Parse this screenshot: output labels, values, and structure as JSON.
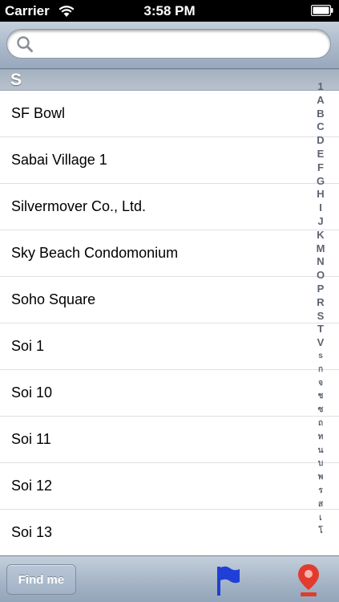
{
  "status_bar": {
    "carrier": "Carrier",
    "time": "3:58 PM"
  },
  "search": {
    "value": "",
    "placeholder": ""
  },
  "section": {
    "letter": "S"
  },
  "rows": [
    "SF Bowl",
    "Sabai Village 1",
    "Silvermover Co., Ltd.",
    "Sky Beach Condomonium",
    "Soho Square",
    "Soi 1",
    "Soi 10",
    "Soi 11",
    "Soi 12",
    "Soi 13"
  ],
  "index": [
    "1",
    "A",
    "B",
    "C",
    "D",
    "E",
    "F",
    "G",
    "H",
    "I",
    "J",
    "K",
    "M",
    "N",
    "O",
    "P",
    "R",
    "S",
    "T",
    "V",
    "s",
    "ก",
    "จ",
    "ช",
    "ซ",
    "ถ",
    "ท",
    "น",
    "บ",
    "พ",
    "ร",
    "ส",
    "เ",
    "โ"
  ],
  "tab_bar": {
    "find_me_label": "Find me",
    "flag_icon": "flag-icon",
    "pin_icon": "location-pin-icon"
  },
  "colors": {
    "flag": "#1f3fd6",
    "pin": "#e23b2e",
    "index_text": "#5c6471"
  }
}
